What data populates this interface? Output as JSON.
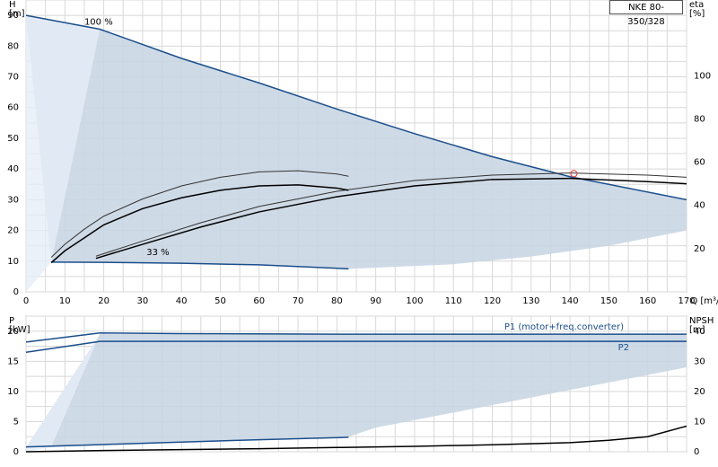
{
  "model_label": "NKE 80-350/328",
  "chart_data": [
    {
      "type": "line",
      "panel": "head-efficiency",
      "xlabel": "Q [m³/h]",
      "ylabel": "H\n[m]",
      "ylabel_right": "eta\n[%]",
      "xlim": [
        0,
        170
      ],
      "ylim": [
        0,
        95
      ],
      "ylim_right": [
        0,
        135
      ],
      "x_ticks": [
        0,
        10,
        20,
        30,
        40,
        50,
        60,
        70,
        80,
        90,
        100,
        110,
        120,
        130,
        140,
        150,
        160,
        170
      ],
      "y_ticks": [
        0,
        10,
        20,
        30,
        40,
        50,
        60,
        70,
        80,
        90
      ],
      "y_ticks_right": [
        20,
        40,
        60,
        80,
        100
      ],
      "grid": true,
      "annotations": [
        {
          "text": "100 %",
          "x": 15,
          "y": 87
        },
        {
          "text": "33 %",
          "x": 31,
          "y": 12
        }
      ],
      "operating_point": {
        "x": 141,
        "y": 38.5
      },
      "area": {
        "name": "operating range",
        "color": "#c9d6e3",
        "polygon": [
          [
            0,
            90
          ],
          [
            19,
            85.5
          ],
          [
            40,
            76
          ],
          [
            60,
            68
          ],
          [
            80,
            59.5
          ],
          [
            100,
            51.5
          ],
          [
            120,
            44
          ],
          [
            140,
            37.5
          ],
          [
            170,
            30
          ],
          [
            170,
            20
          ],
          [
            150,
            15
          ],
          [
            130,
            11.5
          ],
          [
            110,
            9
          ],
          [
            83,
            7.5
          ],
          [
            60,
            8.8
          ],
          [
            40,
            9.3
          ],
          [
            20,
            9.6
          ],
          [
            6.5,
            9.7
          ]
        ]
      },
      "series": [
        {
          "role": "head-max",
          "color": "#1a4e8c",
          "x": [
            0,
            19,
            40,
            60,
            80,
            100,
            120,
            140,
            170
          ],
          "y": [
            90,
            85.5,
            76,
            68,
            59.5,
            51.5,
            44,
            37.5,
            30
          ]
        },
        {
          "role": "head-min",
          "color": "#1a4e8c",
          "x": [
            6.5,
            20,
            40,
            60,
            83
          ],
          "y": [
            9.7,
            9.6,
            9.3,
            8.8,
            7.5
          ]
        },
        {
          "role": "eta-100",
          "color": "#000000",
          "axis": "right",
          "x": [
            18,
            30,
            45,
            60,
            80,
            100,
            120,
            140,
            160,
            170
          ],
          "y": [
            15.5,
            22,
            30,
            37,
            44,
            49,
            52,
            52.5,
            51,
            50
          ]
        },
        {
          "role": "eta-100-upper",
          "color": "#333333",
          "axis": "right",
          "x": [
            18,
            30,
            45,
            60,
            80,
            100,
            120,
            140,
            160,
            170
          ],
          "y": [
            16.5,
            23.5,
            32,
            39.5,
            46.5,
            51.5,
            54,
            55,
            54,
            53
          ]
        },
        {
          "role": "eta-33",
          "color": "#000000",
          "axis": "right",
          "x": [
            6.5,
            10,
            15,
            20,
            30,
            40,
            50,
            60,
            70,
            80,
            83
          ],
          "y": [
            13.5,
            19,
            25,
            31,
            38.5,
            43.5,
            47,
            49,
            49.5,
            48,
            47
          ]
        },
        {
          "role": "eta-33-upper",
          "color": "#333333",
          "axis": "right",
          "x": [
            6.5,
            10,
            15,
            20,
            30,
            40,
            50,
            60,
            70,
            80,
            83
          ],
          "y": [
            16,
            22,
            29,
            35,
            43,
            49,
            53,
            55.5,
            56,
            54.5,
            53.5
          ]
        }
      ]
    },
    {
      "type": "line",
      "panel": "power-npsh",
      "xlabel": "",
      "ylabel": "P\n[kW]",
      "ylabel_right": "NPSH\n[m]",
      "xlim": [
        0,
        170
      ],
      "ylim": [
        0,
        22.5
      ],
      "ylim_right": [
        0,
        45
      ],
      "y_ticks": [
        0,
        5,
        10,
        15,
        20
      ],
      "y_ticks_right": [
        0,
        10,
        20,
        30,
        40
      ],
      "grid": true,
      "area": {
        "name": "power range",
        "color": "#c9d6e3",
        "polygon": [
          [
            0,
            0.7
          ],
          [
            19,
            19.5
          ],
          [
            170,
            19.5
          ],
          [
            170,
            14
          ],
          [
            150,
            11.5
          ],
          [
            130,
            9
          ],
          [
            110,
            6.5
          ],
          [
            90,
            4
          ],
          [
            83,
            2.5
          ],
          [
            40,
            1.5
          ],
          [
            6.5,
            0.8
          ]
        ]
      },
      "series": [
        {
          "name": "P1 (motor+freq.converter)",
          "color": "#1a4e8c",
          "x": [
            0,
            19,
            40,
            80,
            120,
            170
          ],
          "y": [
            18.2,
            19.7,
            19.6,
            19.5,
            19.5,
            19.5
          ]
        },
        {
          "name": "P2",
          "color": "#1a4e8c",
          "x": [
            0,
            19,
            60,
            120,
            170
          ],
          "y": [
            16.5,
            18.3,
            18.3,
            18.3,
            18.3
          ]
        },
        {
          "role": "P1-33",
          "color": "#1a4e8c",
          "x": [
            0,
            20,
            40,
            60,
            83
          ],
          "y": [
            0.8,
            1.2,
            1.6,
            2.0,
            2.4
          ]
        },
        {
          "role": "NPSH",
          "color": "#000000",
          "axis": "right",
          "x": [
            0,
            20,
            40,
            60,
            80,
            100,
            120,
            140,
            150,
            160,
            170
          ],
          "y": [
            0,
            0.4,
            0.7,
            1.0,
            1.4,
            1.8,
            2.3,
            3.0,
            3.8,
            5.0,
            8.5
          ]
        }
      ]
    }
  ]
}
